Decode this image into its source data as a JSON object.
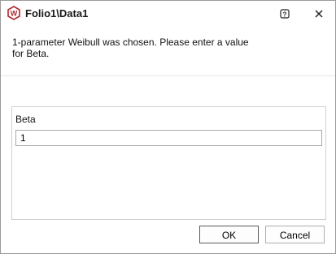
{
  "window": {
    "title": "Folio1\\Data1",
    "help_icon": "question-icon",
    "close_icon": "close-icon",
    "app_icon": "weibull-w-icon",
    "accent_color": "#b3262b"
  },
  "message": {
    "text": "1-parameter Weibull was chosen. Please enter a value for Beta."
  },
  "form": {
    "beta_label": "Beta",
    "beta_value": "1"
  },
  "buttons": {
    "ok_label": "OK",
    "cancel_label": "Cancel"
  }
}
